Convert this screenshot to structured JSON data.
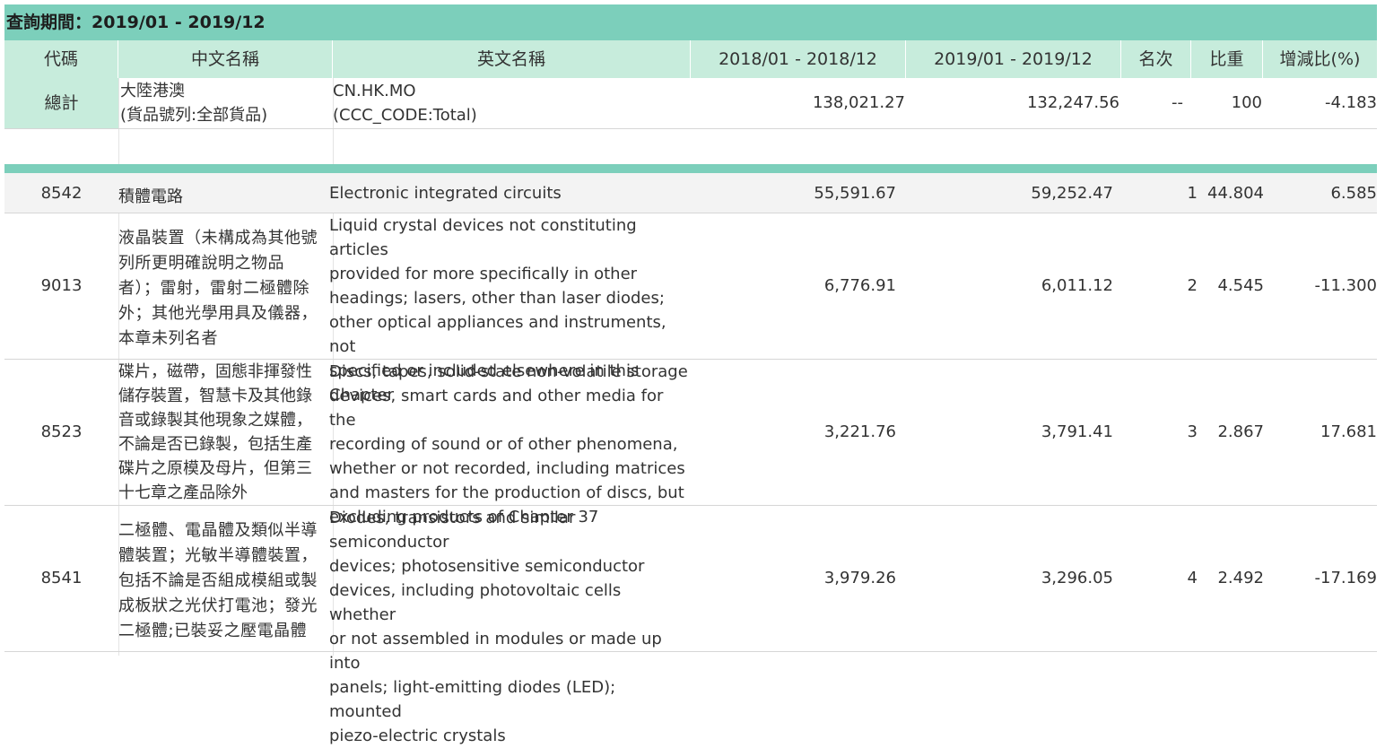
{
  "title": "查詢期間：2019/01 - 2019/12",
  "headers": {
    "code": "代碼",
    "zh_name": "中文名稱",
    "en_name": "英文名稱",
    "period_2018": "2018/01 - 2018/12",
    "period_2019": "2019/01 - 2019/12",
    "rank": "名次",
    "share": "比重",
    "change": "增減比(%)"
  },
  "total": {
    "code": "總計",
    "zh_line1": "大陸港澳",
    "zh_line2": "(貨品號列:全部貨品)",
    "en_line1": "CN.HK.MO",
    "en_line2": "(CCC_CODE:Total)",
    "v2018": "138,021.27",
    "v2019": "132,247.56",
    "rank": "--",
    "share": "100",
    "change": "-4.183"
  },
  "rows": [
    {
      "code": "8542",
      "zh": [
        "積體電路"
      ],
      "en": [
        "Electronic integrated circuits"
      ],
      "v2018": "55,591.67",
      "v2019": "59,252.47",
      "rank": "1",
      "share": "44.804",
      "change": "6.585"
    },
    {
      "code": "9013",
      "zh": [
        "液晶裝置（未構成為其他號",
        "列所更明確說明之物品",
        "者）；雷射，雷射二極體除",
        "外；其他光學用具及儀器，",
        "本章未列名者"
      ],
      "en": [
        "Liquid crystal devices not constituting articles",
        "provided for more specifically in other",
        "headings; lasers, other than laser diodes;",
        "other optical appliances and instruments, not",
        "specified or included elsewhere in this",
        "Chapter"
      ],
      "v2018": "6,776.91",
      "v2019": "6,011.12",
      "rank": "2",
      "share": "4.545",
      "change": "-11.300"
    },
    {
      "code": "8523",
      "zh": [
        "碟片，磁帶，固態非揮發性",
        "儲存裝置，智慧卡及其他錄",
        "音或錄製其他現象之媒體，",
        "不論是否已錄製，包括生產",
        "碟片之原模及母片，但第三",
        "十七章之產品除外"
      ],
      "en": [
        "Discs, tapes, solid-state non-volatile storage",
        "devices, smart cards and other media for the",
        "recording of sound or of other phenomena,",
        "whether or not recorded, including matrices",
        "and masters for the production of discs, but",
        "excluding products of Chapter 37"
      ],
      "v2018": "3,221.76",
      "v2019": "3,791.41",
      "rank": "3",
      "share": "2.867",
      "change": "17.681"
    },
    {
      "code": "8541",
      "zh": [
        "二極體、電晶體及類似半導",
        "體裝置；光敏半導體裝置，",
        "包括不論是否組成模組或製",
        "成板狀之光伏打電池；發光",
        "二極體;已裝妥之壓電晶體"
      ],
      "en": [
        "Diodes, transistors and similar semiconductor",
        "devices; photosensitive semiconductor",
        "devices, including photovoltaic cells whether",
        "or not assembled in modules or made up into",
        "panels; light-emitting diodes (LED); mounted",
        "piezo-electric crystals"
      ],
      "v2018": "3,979.26",
      "v2019": "3,296.05",
      "rank": "4",
      "share": "2.492",
      "change": "-17.169"
    }
  ]
}
